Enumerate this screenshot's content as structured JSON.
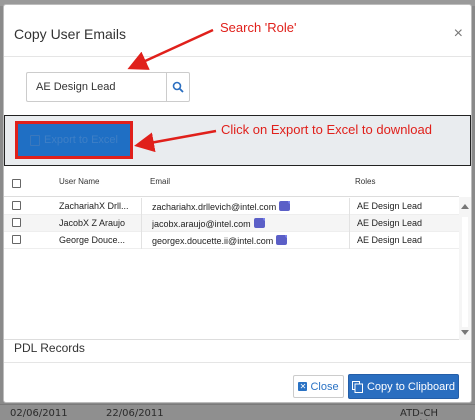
{
  "background": {
    "bottom_row": {
      "date1": "02/06/2011",
      "date2": "22/06/2011",
      "status": "ATD-CH Working"
    }
  },
  "modal": {
    "title": "Copy User Emails",
    "close_glyph": "×",
    "search": {
      "value": "AE Design Lead",
      "icon": "search-icon"
    },
    "export_button": {
      "label": "Export to Excel",
      "icon": "excel-icon"
    },
    "table": {
      "columns": [
        "User Name",
        "Email",
        "Roles"
      ],
      "rows": [
        {
          "user": "ZachariahX Drll...",
          "email": "zachariahx.drllevich@intel.com",
          "role": "AE Design Lead"
        },
        {
          "user": "JacobX Z Araujo",
          "email": "jacobx.araujo@intel.com",
          "role": "AE Design Lead"
        },
        {
          "user": "George Douce...",
          "email": "georgex.doucette.ii@intel.com",
          "role": "AE Design Lead"
        }
      ]
    },
    "pdl_label": "PDL Records",
    "close_button": "Close",
    "copy_button": "Copy to Clipboard"
  },
  "annotations": {
    "search_note": "Search 'Role'",
    "export_note": "Click on Export to Excel to download",
    "color": "#e0201b"
  }
}
